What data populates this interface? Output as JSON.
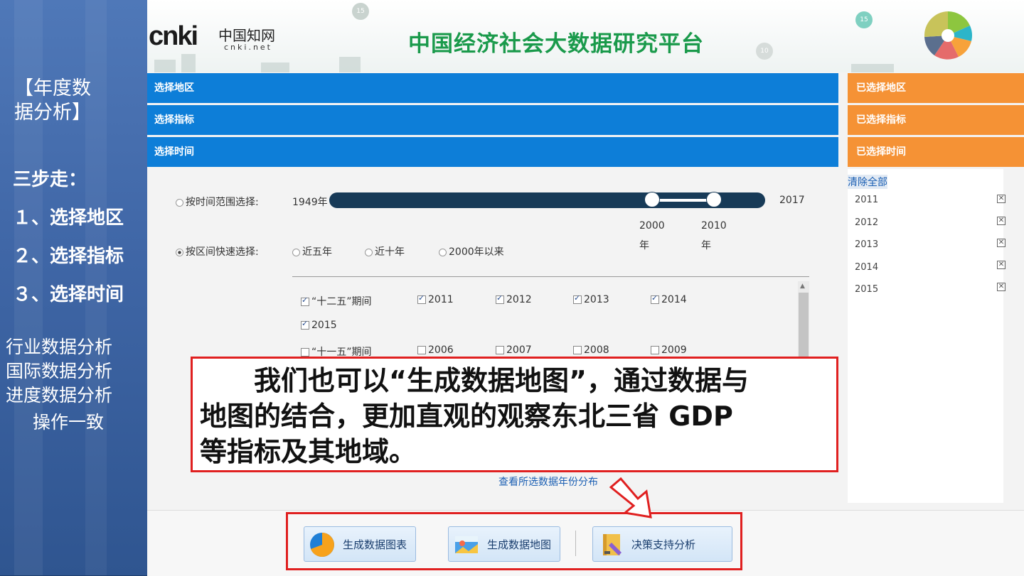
{
  "sidebar": {
    "title_line1": "【年度数",
    "title_line2": "据分析】",
    "steps_heading": "三步走：",
    "step1": "１、选择地区",
    "step2": "２、选择指标",
    "step3": "３、选择时间",
    "other1": "行业数据分析",
    "other2": "国际数据分析",
    "other3": "进度数据分析",
    "other4": "操作一致"
  },
  "banner": {
    "logo_text": "cnki",
    "logo_cn": "中国知网",
    "logo_net": "cnki.net",
    "title": "中国经济社会大数据研究平台",
    "pin1": "15",
    "pin2": "15",
    "pin3": "10"
  },
  "sections": {
    "region": "选择地区",
    "indicator": "选择指标",
    "time": "选择时间",
    "selected_region": "已选择地区",
    "selected_indicator": "已选择指标",
    "selected_time": "已选择时间"
  },
  "time": {
    "range_label": "按时间范围选择:",
    "range_start": "1949年",
    "range_end": "2017",
    "handle_left_year": "2000",
    "handle_left_unit": "年",
    "handle_right_year": "2010",
    "handle_right_unit": "年",
    "handle_left_value": 2000,
    "handle_right_value": 2010,
    "range_min": 1949,
    "range_max": 2017,
    "quick_label": "按区间快速选择:",
    "quick_options": [
      "近五年",
      "近十年",
      "2000年以来"
    ],
    "periods": {
      "p12_label": "“十二五”期间",
      "p12_years": [
        "2011",
        "2012",
        "2013",
        "2014",
        "2015"
      ],
      "p11_label": "“十一五”期间",
      "p11_years": [
        "2006",
        "2007",
        "2008",
        "2009"
      ]
    },
    "view_distribution": "查看所选数据年份分布"
  },
  "selected": {
    "clear_all": "清除全部",
    "years": [
      "2011",
      "2012",
      "2013",
      "2014",
      "2015"
    ]
  },
  "actions": {
    "chart": "生成数据图表",
    "map": "生成数据地图",
    "decision": "决策支持分析"
  },
  "callout": {
    "line1": "　　我们也可以“生成数据地图”，通过数据与",
    "line2": "地图的结合，更加直观的观察东北三省 GDP",
    "line3": "等指标及其地域。"
  },
  "colors": {
    "blue_bar": "#0d7ed8",
    "orange_bar": "#f59235",
    "accent_red": "#e02020",
    "title_green": "#1a9a4b"
  }
}
